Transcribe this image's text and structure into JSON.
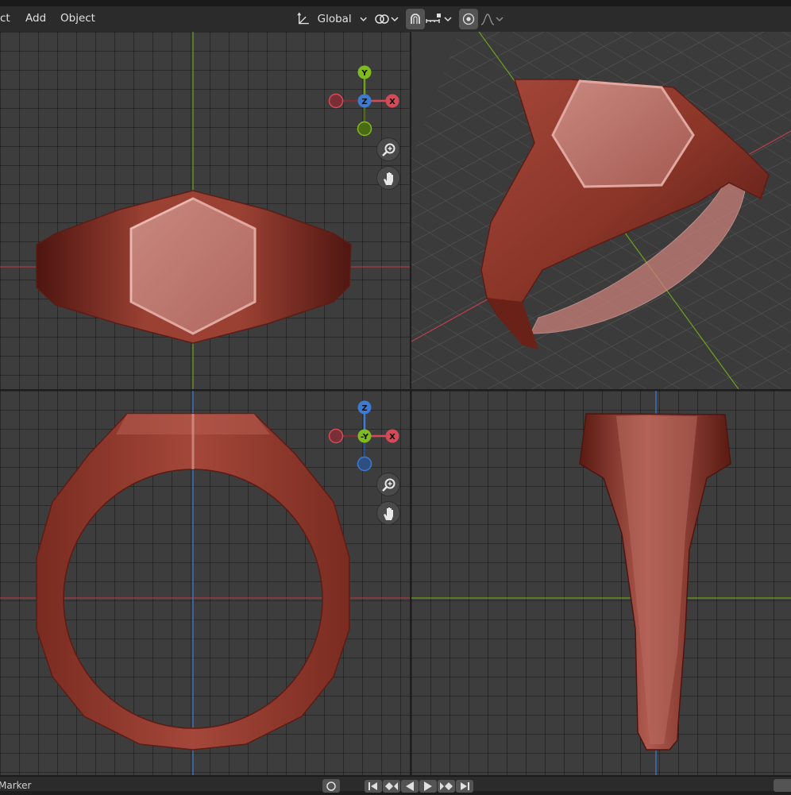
{
  "header": {
    "menu": [
      "ct",
      "Add",
      "Object"
    ],
    "orientation_label": "Global"
  },
  "gizmos": {
    "front": {
      "up": "Y",
      "center": "Z",
      "right": "X"
    },
    "top": {
      "up": "Z",
      "center": "-Y",
      "right": "X"
    }
  },
  "timeline": {
    "marker_label": "Marker"
  },
  "colors": {
    "x_axis": "#d64a58",
    "y_axis": "#7fbb1c",
    "z_axis": "#3d7ad4",
    "ring_material": "#8b3628",
    "viewport_bg": "#3d3d3d"
  },
  "icons": [
    "transform-orientation-icon",
    "chevron-down-icon",
    "pivot-icon",
    "snap-magnet-icon",
    "snap-increment-icon",
    "proportional-edit-icon",
    "falloff-curve-icon",
    "zoom-icon",
    "hand-pan-icon",
    "jump-start-icon",
    "prev-keyframe-icon",
    "play-reverse-icon",
    "play-icon",
    "next-keyframe-icon",
    "jump-end-icon"
  ]
}
